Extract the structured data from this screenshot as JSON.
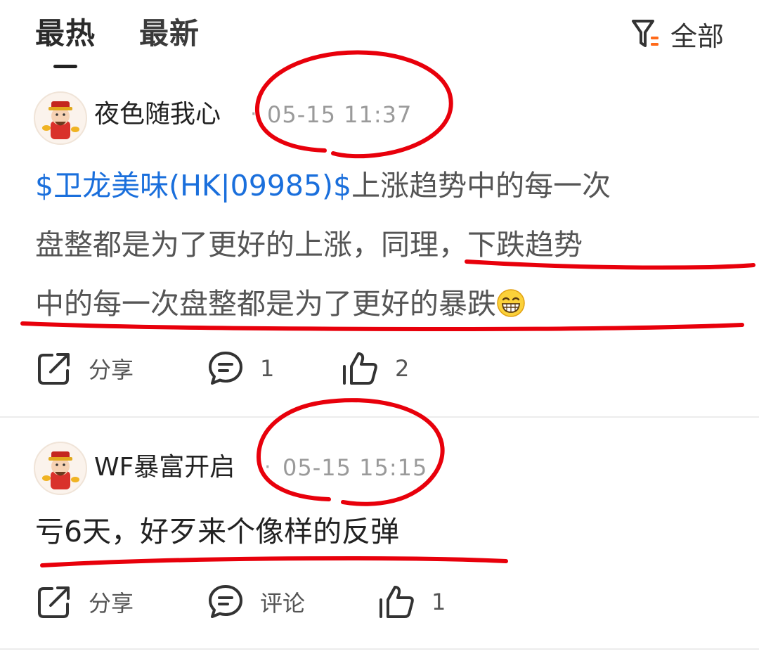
{
  "tabs": {
    "hot": "最热",
    "newest": "最新"
  },
  "filter": {
    "label": "全部",
    "icon": "filter-icon"
  },
  "posts": [
    {
      "author": "夜色随我心",
      "time": "05-15 11:37",
      "stock_link": "$卫龙美味(HK|09985)$",
      "text_line_1": "上涨趋势中的每一次",
      "text_line_2": "盘整都是为了更好的上涨，同理，下跌趋势",
      "text_line_3": "中的每一次盘整都是为了更好的暴跌",
      "emoji": "grinning-face-emoji",
      "share_label": "分享",
      "comment_count": "1",
      "like_count": "2"
    },
    {
      "author": "WF暴富开启",
      "time": "05-15 15:15",
      "text": "亏6天，好歹来个像样的反弹",
      "share_label": "分享",
      "comment_label": "评论",
      "like_count": "1"
    }
  ],
  "colors": {
    "link": "#1a6fdc",
    "annotation": "#e8000b",
    "filter_accent": "#ff6a1a"
  }
}
